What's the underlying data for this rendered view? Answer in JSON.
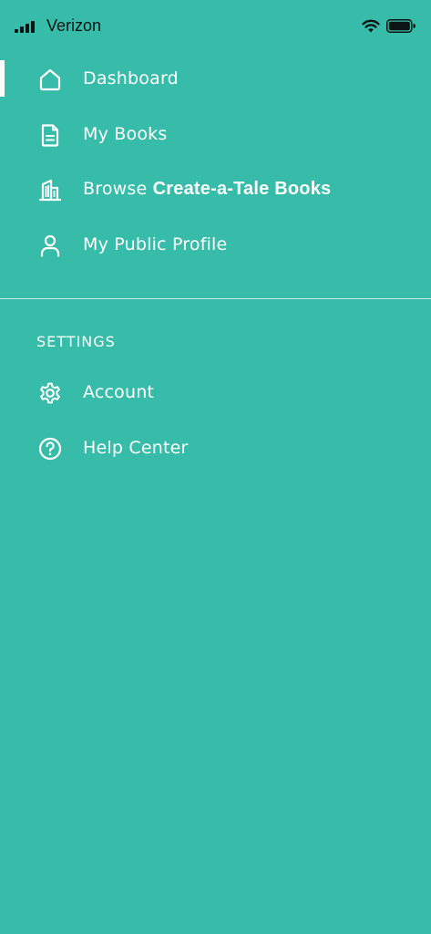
{
  "status_bar": {
    "carrier": "Verizon"
  },
  "menu": {
    "items": [
      {
        "label": "Dashboard",
        "icon": "home-icon",
        "active": true
      },
      {
        "label": "My Books",
        "icon": "document-icon"
      },
      {
        "label": "Browse ",
        "label_bold": "Create-a-Tale Books",
        "icon": "building-icon"
      },
      {
        "label": "My Public Profile",
        "icon": "user-icon"
      }
    ]
  },
  "settings": {
    "header": "SETTINGS",
    "items": [
      {
        "label": "Account",
        "icon": "gear-icon"
      },
      {
        "label": "Help Center",
        "icon": "question-circle-icon"
      }
    ]
  },
  "colors": {
    "background": "#37bcaa",
    "text": "#ffffff",
    "status_text": "#0d1414"
  }
}
